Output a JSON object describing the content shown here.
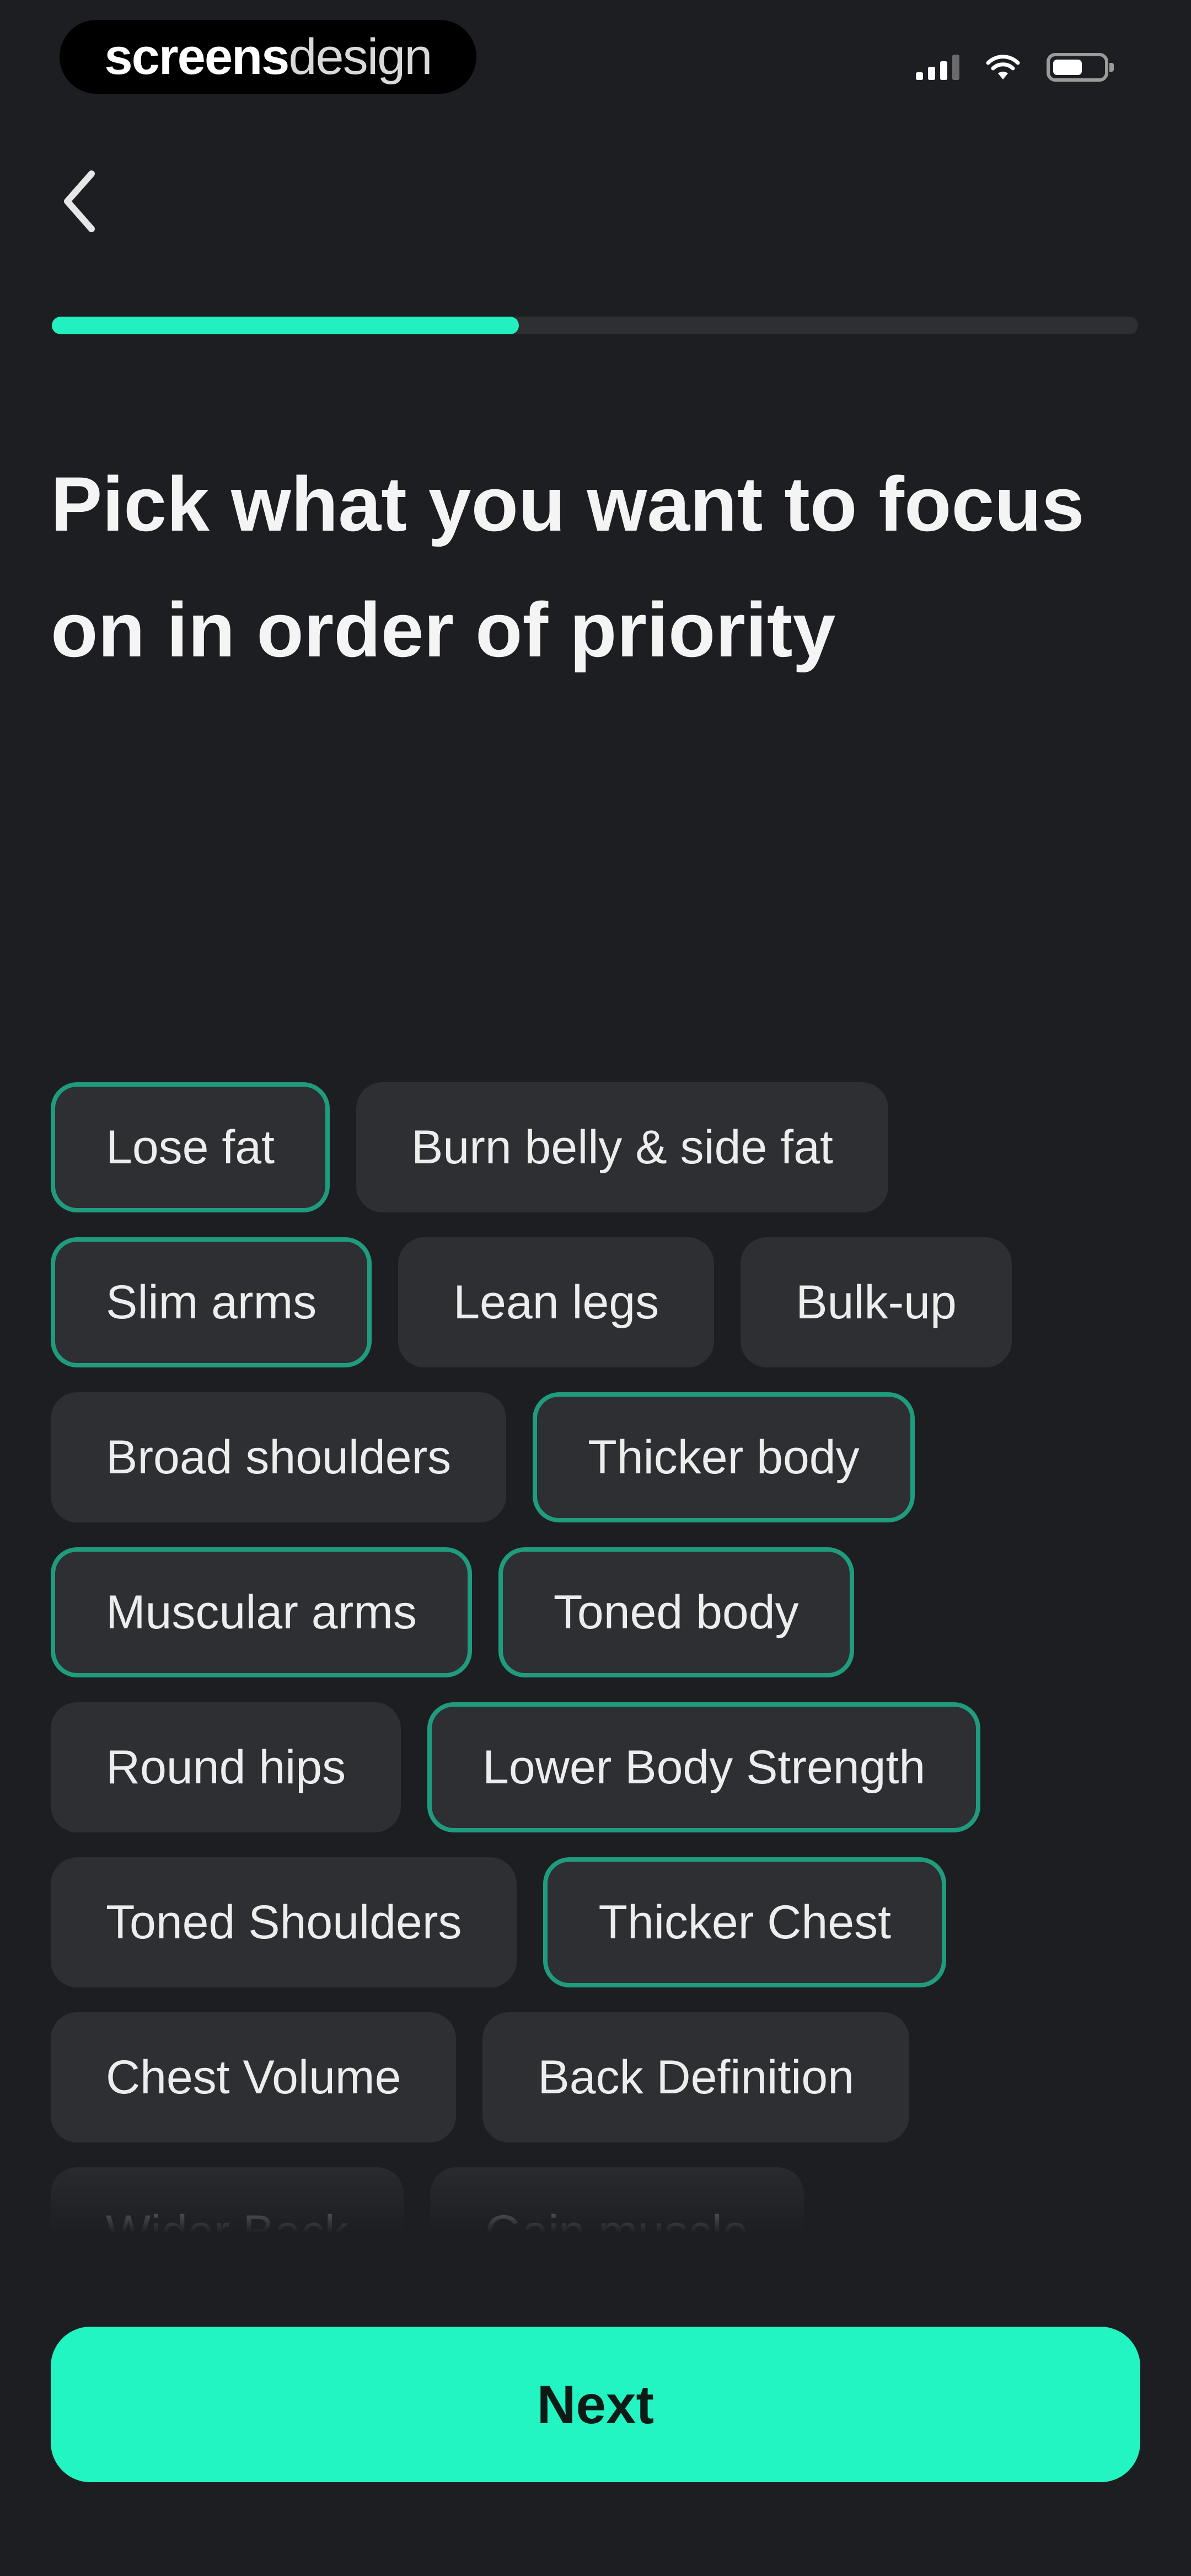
{
  "status_bar": {
    "brand_bold": "screens",
    "brand_regular": "design",
    "icons": [
      "signal-icon",
      "wifi-icon",
      "battery-icon"
    ]
  },
  "nav": {
    "back_icon": "chevron-left-icon"
  },
  "progress": {
    "value": 0.43,
    "accent_color": "#23f0c0"
  },
  "title": "Pick what you want to focus on in order of priority",
  "chips": [
    {
      "label": "Lose fat",
      "selected": true
    },
    {
      "label": "Burn belly & side fat",
      "selected": false
    },
    {
      "label": "Slim arms",
      "selected": true
    },
    {
      "label": "Lean legs",
      "selected": false
    },
    {
      "label": "Bulk-up",
      "selected": false
    },
    {
      "label": "Broad shoulders",
      "selected": false
    },
    {
      "label": "Thicker body",
      "selected": true
    },
    {
      "label": "Muscular arms",
      "selected": true
    },
    {
      "label": "Toned body",
      "selected": true
    },
    {
      "label": "Round hips",
      "selected": false
    },
    {
      "label": "Lower Body Strength",
      "selected": true
    },
    {
      "label": "Toned Shoulders",
      "selected": false
    },
    {
      "label": "Thicker Chest",
      "selected": true
    },
    {
      "label": "Chest Volume",
      "selected": false
    },
    {
      "label": "Back Definition",
      "selected": false
    },
    {
      "label": "Wider Back",
      "selected": false
    },
    {
      "label": "Gain muscle",
      "selected": false
    }
  ],
  "next_button": {
    "label": "Next",
    "color": "#23f5c2"
  }
}
